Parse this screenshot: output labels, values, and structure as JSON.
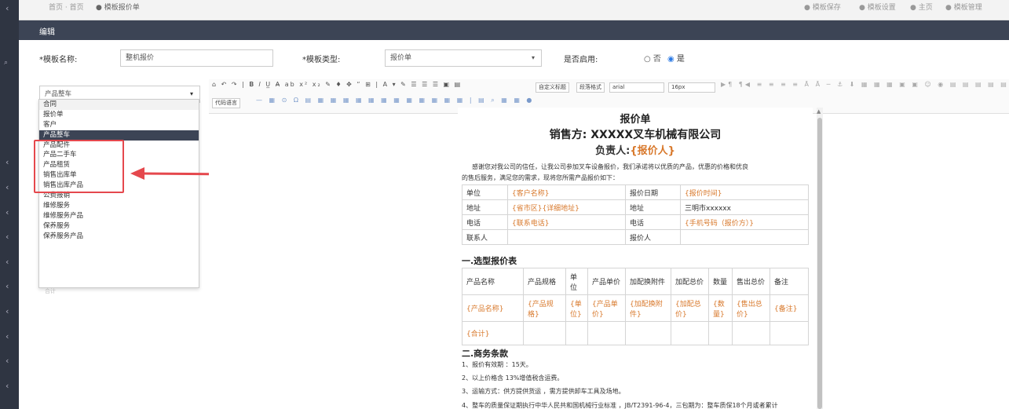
{
  "top_strip": {
    "items": [
      "首页  ·  首页",
      "● 模板报价单",
      "● 模板保存",
      "● 模板设置",
      "● 主页",
      "● 模板管理"
    ]
  },
  "edit_bar": {
    "title": "编辑"
  },
  "form": {
    "template_name_label": "*模板名称:",
    "template_name_value": "整机报价",
    "template_type_label": "*模板类型:",
    "template_type_value": "报价单",
    "enabled_label": "是否启用:",
    "enabled_no": "否",
    "enabled_yes": "是",
    "enabled_selected": "是"
  },
  "type_dropdown": {
    "selected": "产品整车",
    "options": [
      "合同",
      "报价单",
      "客户",
      "产品整车",
      "产品配件",
      "产品二手车",
      "产品租赁",
      "销售出库单",
      "销售出库产品",
      "公费报销",
      "维修服务",
      "维修服务产品",
      "保养服务",
      "保养服务产品"
    ],
    "highlighted": "产品整车",
    "below_text": "合计"
  },
  "toolbar": {
    "custom_title": "自定义标题",
    "paragraph_format": "段落格式",
    "font_family": "arial",
    "font_size": "16px",
    "code_lang": "代码语言"
  },
  "doc": {
    "title": "报价单",
    "seller": "销售方: XXXXX叉车机械有限公司",
    "owner_prefix": "负责人:",
    "owner_var": "{报价人}",
    "intro1": "感谢您对我公司的信任，让我公司参加叉车设备报价，我们承诺将以优质的产品，优惠的价格和优良",
    "intro2": "的售后服务，满足您的需求，现将您所需产品报价如下：",
    "info_rows": [
      [
        "单位",
        "{客户名称}",
        "报价日期",
        "{报价时间}"
      ],
      [
        "地址",
        "{省市区}{详细地址}",
        "地址",
        "三明市xxxxxx"
      ],
      [
        "电话",
        "{联系电话}",
        "电话",
        "{手机号码（报价方）}"
      ],
      [
        "联系人",
        "",
        "报价人",
        ""
      ]
    ],
    "section1": "一.选型报价表",
    "sel_headers": [
      "产品名称",
      "产品规格",
      "单位",
      "产品单价",
      "加配换附件",
      "加配总价",
      "数量",
      "售出总价",
      "备注"
    ],
    "sel_row": [
      "{产品名称}",
      "{产品规格}",
      "{单位}",
      "{产品单价}",
      "{加配换附件}",
      "{加配总价}",
      "{数量}",
      "{售出总价}",
      "{备注}"
    ],
    "sel_total": "{合计}",
    "section2": "二.商务条款",
    "terms": [
      "1、报价有效期 ：15天。",
      "2、以上价格含 13%增值税含运费。",
      "3、运输方式：供方提供货运 ，需方提供卸车工具及场地。",
      "4、整车的质量保证期执行中华人民共和国机械行业标准 ，JB/T2391-96-4，三包期为：整车质保18个月或者累计"
    ]
  },
  "colors": {
    "dark": "#3c4455",
    "accent_orange": "#d8782b",
    "annotation_red": "#e5484d",
    "radio_blue": "#2d7be5"
  }
}
